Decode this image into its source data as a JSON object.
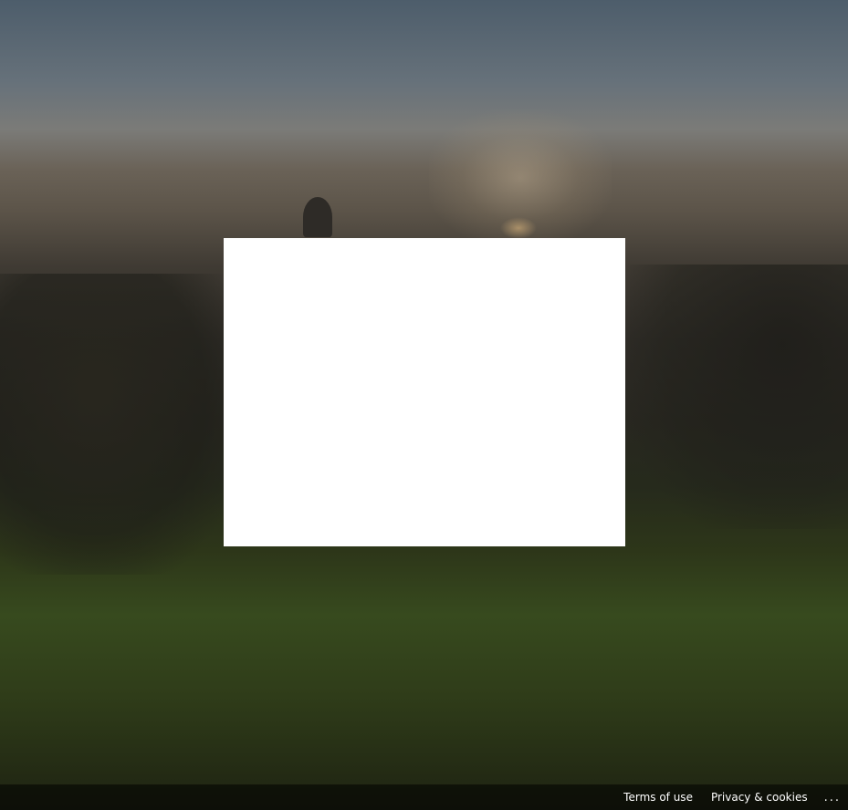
{
  "footer": {
    "terms_label": "Terms of use",
    "privacy_label": "Privacy & cookies",
    "more_label": "..."
  },
  "icons": {
    "more": "ellipsis-icon"
  },
  "colors": {
    "dialog_background": "#ffffff",
    "footer_background": "#000000",
    "footer_text": "#ffffff"
  }
}
